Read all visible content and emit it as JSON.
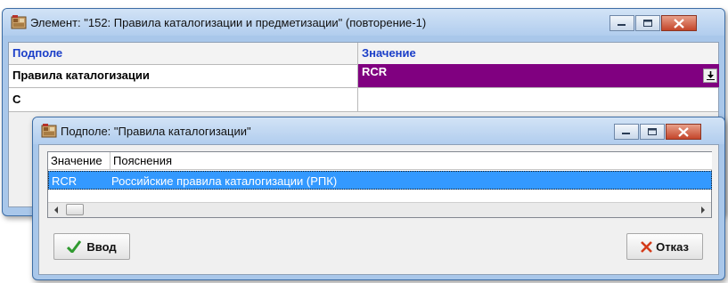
{
  "main_window": {
    "title": "Элемент: \"152: Правила каталогизации и предметизации\" (повторение-1)",
    "grid": {
      "columns": [
        "Подполе",
        "Значение"
      ],
      "rows": [
        {
          "field": "Правила каталогизации",
          "value": "RCR"
        },
        {
          "field": "С",
          "value": ""
        }
      ]
    }
  },
  "sub_window": {
    "title": "Подполе: \"Правила каталогизации\"",
    "list": {
      "columns": [
        "Значение",
        "Пояснения"
      ],
      "rows": [
        {
          "value": "RCR",
          "description": "Российские правила каталогизации (РПК)"
        }
      ]
    },
    "ok_label": "Ввод",
    "cancel_label": "Отказ"
  },
  "colors": {
    "value_cell_bg": "#800080",
    "header_text": "#1a3ec8",
    "selection": "#3399ff",
    "close_button": "#c4452a",
    "ok_check": "#2f9a2f",
    "cancel_x": "#d43b1a"
  }
}
